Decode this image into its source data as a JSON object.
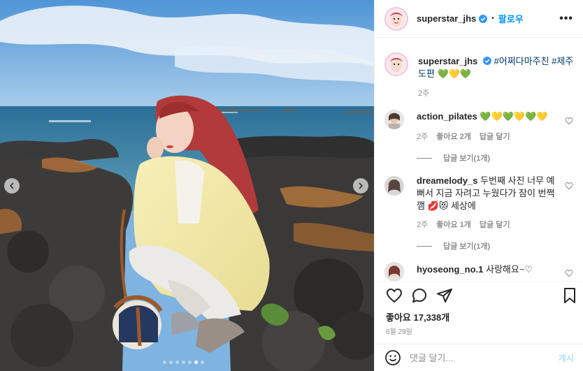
{
  "post": {
    "username": "superstar_jhs",
    "follow_label": "팔로우",
    "more_label": "•••",
    "caption_hashtags": "#어쩌다마주친 #제주도편",
    "caption_emoji": "💚💛💚",
    "caption_time": "2주"
  },
  "comments": [
    {
      "username": "action_pilates",
      "text": "💚💛💚💛💚💛",
      "time": "2주",
      "likes": "좋아요 2개",
      "reply": "답글 달기",
      "view_replies": "답글 보기(1개)"
    },
    {
      "username": "dreamelody_s",
      "text": "두번째 사진 너무 예뻐서 지금 자려고 누웠다가 잠이 번쩍 깸 💋😻 세상에",
      "time": "2주",
      "likes": "좋아요 1개",
      "reply": "답글 달기",
      "view_replies": "답글 보기(1개)"
    },
    {
      "username": "hyoseong_no.1",
      "text": "사랑해요~♡"
    }
  ],
  "actions": {
    "likes": "좋아요 17,338개",
    "date": "6월 29일"
  },
  "comment_box": {
    "placeholder": "댓글 달기...",
    "post_label": "게시"
  },
  "carousel": {
    "slide_count": 7,
    "active_index": 5
  },
  "colors": {
    "link_blue": "#0095f6",
    "hashtag": "#00376b",
    "muted": "#8e8e8e"
  }
}
